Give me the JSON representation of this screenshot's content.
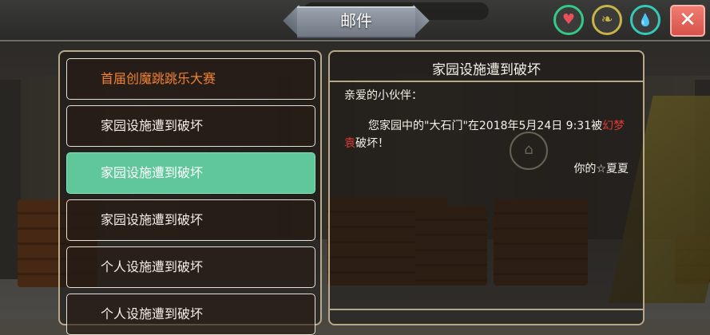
{
  "topbar": {
    "hint_text": "",
    "title": "邮件",
    "close_label": "✕"
  },
  "status_icons": {
    "health": {
      "icon": "heart-icon",
      "glyph": "♥",
      "color": "#e8505b"
    },
    "food": {
      "icon": "food-icon",
      "glyph": "❧",
      "color": "#c8b34a"
    },
    "water": {
      "icon": "water-drop-icon",
      "glyph": "💧",
      "color": "#34c9b8"
    }
  },
  "mail_list": [
    {
      "label": "首届创魔跳跳乐大赛",
      "special": true,
      "selected": false
    },
    {
      "label": "家园设施遭到破坏",
      "special": false,
      "selected": false
    },
    {
      "label": "家园设施遭到破坏",
      "special": false,
      "selected": true
    },
    {
      "label": "家园设施遭到破坏",
      "special": false,
      "selected": false
    },
    {
      "label": "个人设施遭到破坏",
      "special": false,
      "selected": false
    },
    {
      "label": "个人设施遭到破坏",
      "special": false,
      "selected": false
    }
  ],
  "detail": {
    "title": "家园设施遭到破坏",
    "greeting": "亲爱的小伙伴：",
    "body_part1": "您家园中的\"大石门\"在2018年5月24日 9:31被",
    "body_attacker": "幻梦袁",
    "body_part2": "破坏！",
    "signature": "你的☆夏夏"
  },
  "colors": {
    "accent_green": "#5fc79a",
    "special_orange": "#f08232",
    "attacker_red": "#e03a33",
    "close_red": "#d6524a"
  }
}
